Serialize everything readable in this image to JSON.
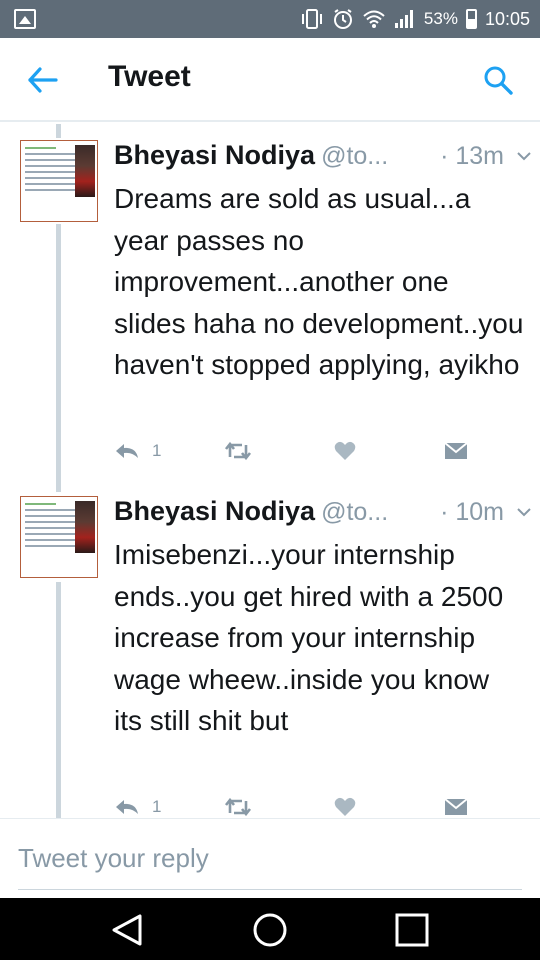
{
  "status_bar": {
    "battery_percent": "53%",
    "time": "10:05"
  },
  "app_bar": {
    "title": "Tweet"
  },
  "tweets": [
    {
      "name": "Bheyasi Nodiya",
      "handle": "@to...",
      "time": "· 13m",
      "text": "Dreams are sold as usual...a year passes no improvement...another one slides haha no development..you haven't stopped applying, ayikho",
      "reply_count": "1"
    },
    {
      "name": "Bheyasi Nodiya",
      "handle": "@to...",
      "time": "· 10m",
      "text": "Imisebenzi...your internship ends..you get hired with a 2500 increase from your internship wage wheew..inside you know its still shit but",
      "reply_count": "1"
    }
  ],
  "reply_box": {
    "placeholder": "Tweet your reply"
  },
  "colors": {
    "status_bar": "#5f6c78",
    "accent": "#1da1f2",
    "text": "#14171a",
    "muted": "#8899a6"
  }
}
